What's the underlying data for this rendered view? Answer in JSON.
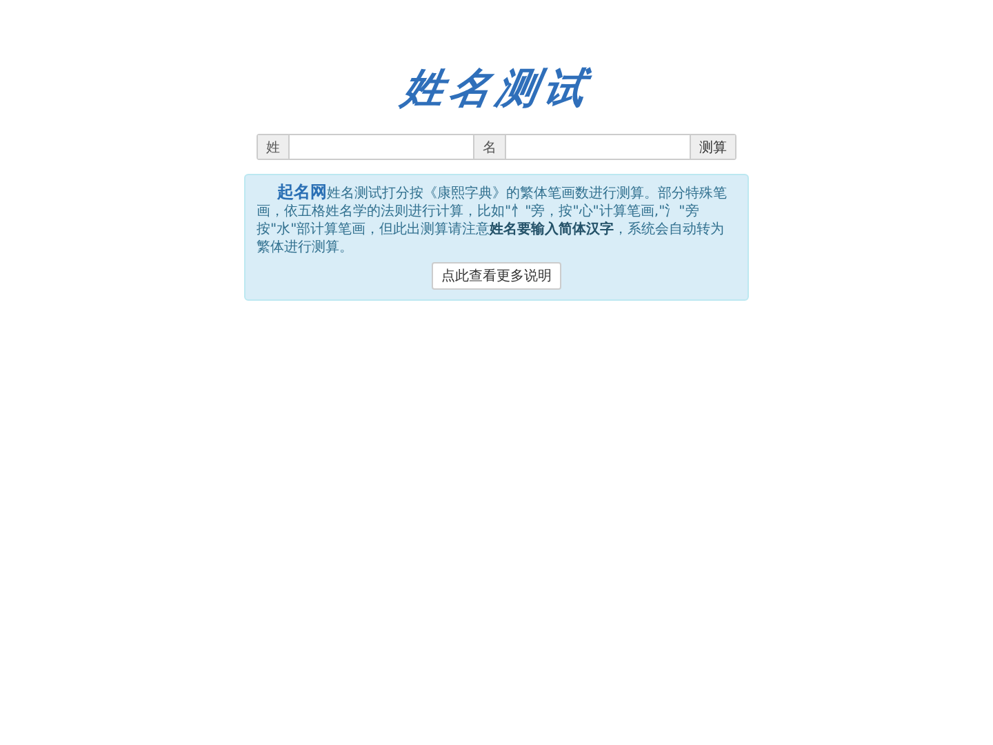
{
  "logo": "姓名测试",
  "form": {
    "surname_label": "姓",
    "given_label": "名",
    "submit": "测算"
  },
  "notice": {
    "lead": "起名网",
    "text": "姓名测试打分按《康熙字典》的繁体笔画数进行测算。部分特殊笔画，依五格姓名学的法则进行计算，比如\"忄\"旁，按\"心\"计算笔画,\"氵\"旁按\"水\"部计算笔画，但此出测算请注意**姓名要输入简体汉字**，系统会自动转为繁体进行测算。",
    "button": "点此查看更多说明"
  }
}
